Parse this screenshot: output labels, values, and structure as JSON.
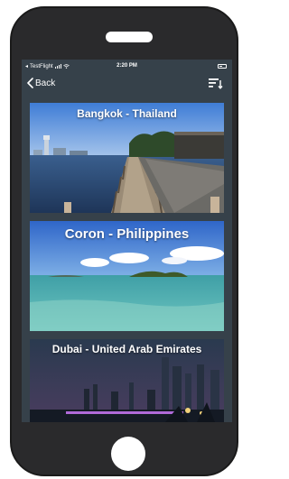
{
  "status_bar": {
    "carrier": "TestFlight",
    "time": "2:20 PM"
  },
  "nav": {
    "back_label": "Back",
    "back_icon": "chevron-left-icon",
    "sort_icon": "sort-descending-icon"
  },
  "destinations": [
    {
      "title": "Bangkok - Thailand"
    },
    {
      "title": "Coron - Philippines"
    },
    {
      "title": "Dubai - United Arab Emirates"
    }
  ],
  "colors": {
    "phone_body": "#2a2a2c",
    "screen_background": "#36414a",
    "text": "#ffffff"
  }
}
